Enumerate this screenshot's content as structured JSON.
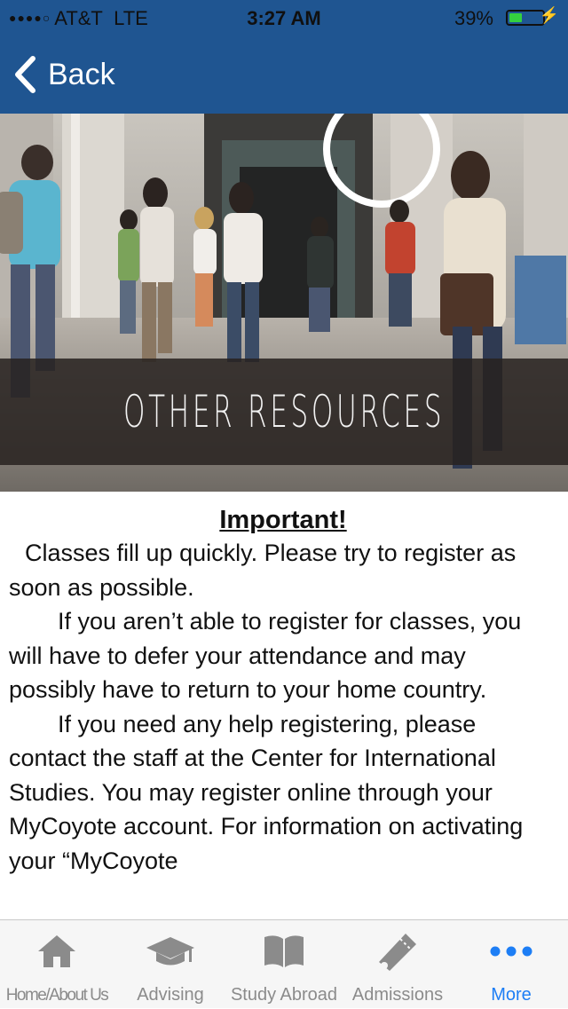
{
  "status_bar": {
    "carrier": "AT&T",
    "network": "LTE",
    "time": "3:27 AM",
    "battery_percent": "39%",
    "battery_level": 0.39,
    "signal_bars": 4,
    "signal_bars_total": 5
  },
  "nav": {
    "back_label": "Back"
  },
  "hero": {
    "title": "OTHER RESOURCES"
  },
  "content": {
    "heading": "Important!",
    "paragraphs": [
      "Classes fill up quickly. Please try to register as soon as possible.",
      "If you aren’t able to register for classes, you will have to defer your attendance and may possibly have to return to your home country.",
      "If you need any help registering, please contact the staff at the Center for International Studies.  You may register online through your MyCoyote account. For information on activating your “MyCoyote"
    ]
  },
  "tab_bar": {
    "items": [
      {
        "label": "Home/About Us",
        "icon": "home-icon"
      },
      {
        "label": "Advising",
        "icon": "graduation-cap-icon"
      },
      {
        "label": "Study Abroad",
        "icon": "book-icon"
      },
      {
        "label": "Admissions",
        "icon": "ticket-icon"
      },
      {
        "label": "More",
        "icon": "more-icon"
      }
    ],
    "active_index": 4
  },
  "colors": {
    "header_background": "#1f5591",
    "tab_active": "#1d7ef5",
    "tab_inactive": "#8b8b8b",
    "battery_fill": "#34d13f"
  }
}
